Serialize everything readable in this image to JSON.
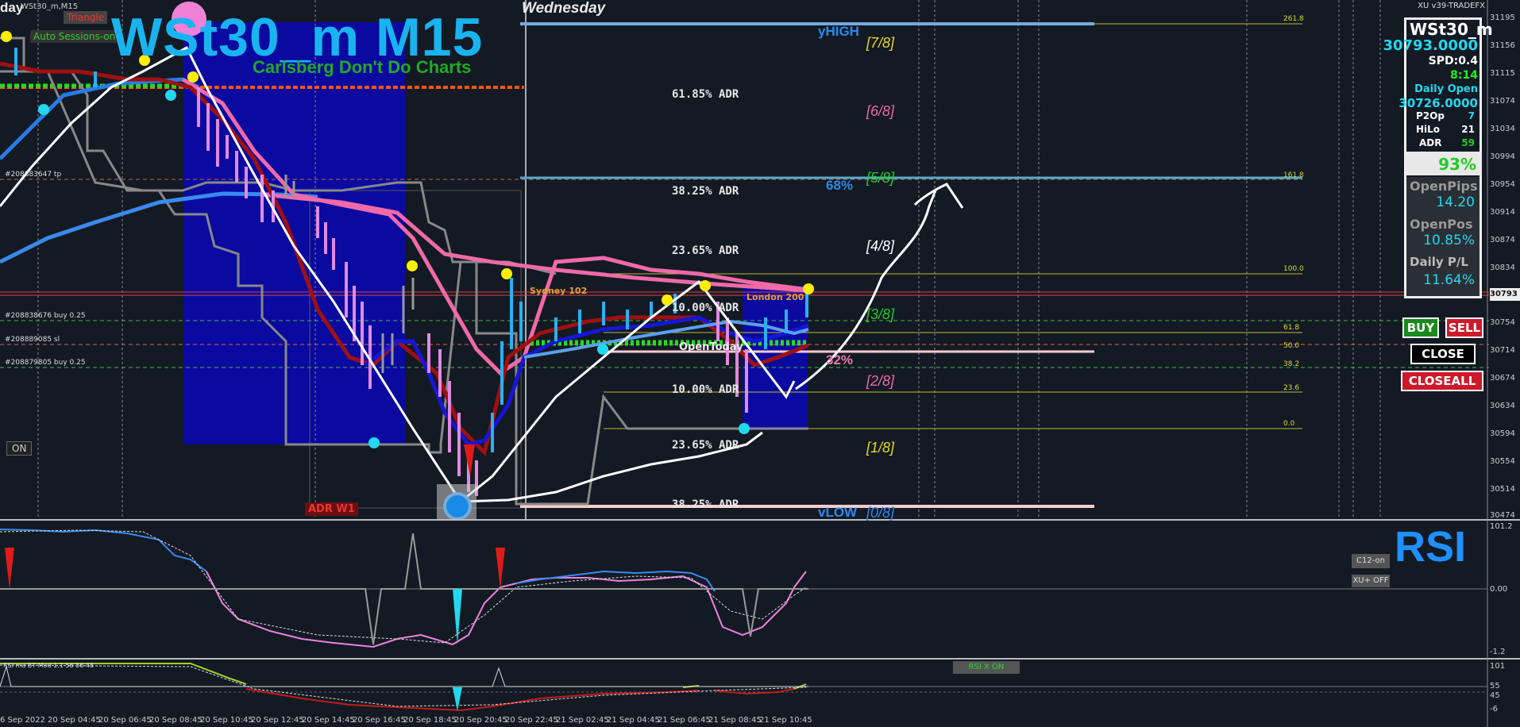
{
  "header": {
    "corner_label": "day",
    "symbol_small": "WSt30_m,M15",
    "pattern_tag": "Triangle",
    "auto_sessions": "Auto Sessions-on",
    "title": "WSt30_m M15",
    "subtitle": "Carlsberg Don't Do Charts",
    "day": "Wednesday",
    "broker": "XU v39-TRADEFX"
  },
  "levels": {
    "yhigh": "yHIGH",
    "ylow": "vLOW",
    "pct68": "68%",
    "pct32": "32%",
    "open_today": "OpenToday",
    "sydney": "Sydney 102",
    "london": "London 200",
    "adr_w1": "ADR W1",
    "on": "ON"
  },
  "adr_labels": [
    "61.85% ADR",
    "38.25% ADR",
    "23.65% ADR",
    "10.00% ADR",
    "10.00% ADR",
    "23.65% ADR",
    "38.25% ADR"
  ],
  "murrey": [
    {
      "label": "[7/8]",
      "color": "#e8d81a"
    },
    {
      "label": "[6/8]",
      "color": "#ee6aa7"
    },
    {
      "label": "[5/8]",
      "color": "#22cc22"
    },
    {
      "label": "[4/8]",
      "color": "#ffffff"
    },
    {
      "label": "[3/8]",
      "color": "#22cc22"
    },
    {
      "label": "[2/8]",
      "color": "#ee6aa7"
    },
    {
      "label": "[1/8]",
      "color": "#e8d81a"
    },
    {
      "label": "[0/8]",
      "color": "#2a8aee"
    }
  ],
  "fib": [
    "261.8",
    "161.8",
    "100.0",
    "61.8",
    "50.0",
    "38.2",
    "23.6",
    "0.0"
  ],
  "orders": [
    "#208883647 tp",
    "#208838676 buy 0.25",
    "#208889085 sl",
    "#208879805 buy 0.25"
  ],
  "price_axis": [
    "31195",
    "31156",
    "31115",
    "31074",
    "31034",
    "30994",
    "30954",
    "30914",
    "30874",
    "30834",
    "30793",
    "30754",
    "30714",
    "30674",
    "30634",
    "30594",
    "30554",
    "30514",
    "30474"
  ],
  "rsi_axis": [
    "101.2",
    "0.00",
    "-1.2"
  ],
  "rsi2_axis": [
    "101",
    "55",
    "45",
    "-6"
  ],
  "time_axis": [
    "6 Sep 2022",
    "20 Sep 04:45",
    "20 Sep 06:45",
    "20 Sep 08:45",
    "20 Sep 10:45",
    "20 Sep 12:45",
    "20 Sep 14:45",
    "20 Sep 16:45",
    "20 Sep 18:45",
    "20 Sep 20:45",
    "20 Sep 22:45",
    "21 Sep 02:45",
    "21 Sep 04:45",
    "21 Sep 06:45",
    "21 Sep 08:45",
    "21 Sep 10:45"
  ],
  "panel": {
    "symbol": "WSt30_m",
    "price": "30793.0000",
    "spread": "SPD:0.4",
    "timer": "8:14",
    "daily_open_label": "Daily Open",
    "daily_open": "30726.0000",
    "p2op_label": "P2Op",
    "p2op": "7",
    "hilo_label": "HiLo",
    "hilo": "21",
    "adr_label": "ADR",
    "adr": "59",
    "pct": "93%",
    "openpips_label": "OpenPips",
    "openpips": "14.20",
    "openpos_label": "OpenPos",
    "openpos": "10.85%",
    "dailypl_label": "Daily P/L",
    "dailypl": "11.64%",
    "current_price_tag": "30793"
  },
  "buttons": {
    "buy": "BUY",
    "sell": "SELL",
    "close": "CLOSE",
    "closeall": "CLOSEALL"
  },
  "rsi": {
    "title": "RSI",
    "c12": "C12-on",
    "xu": "XU+ OFF",
    "rsix": "RSI X ON",
    "rsi2_label": "RSI ma BT Mod 1.1 56 56 48"
  },
  "colors": {
    "background": "#131a24",
    "accent": "#19b4f0",
    "buy": "#1a8a1a",
    "sell": "#cc1a2a"
  }
}
